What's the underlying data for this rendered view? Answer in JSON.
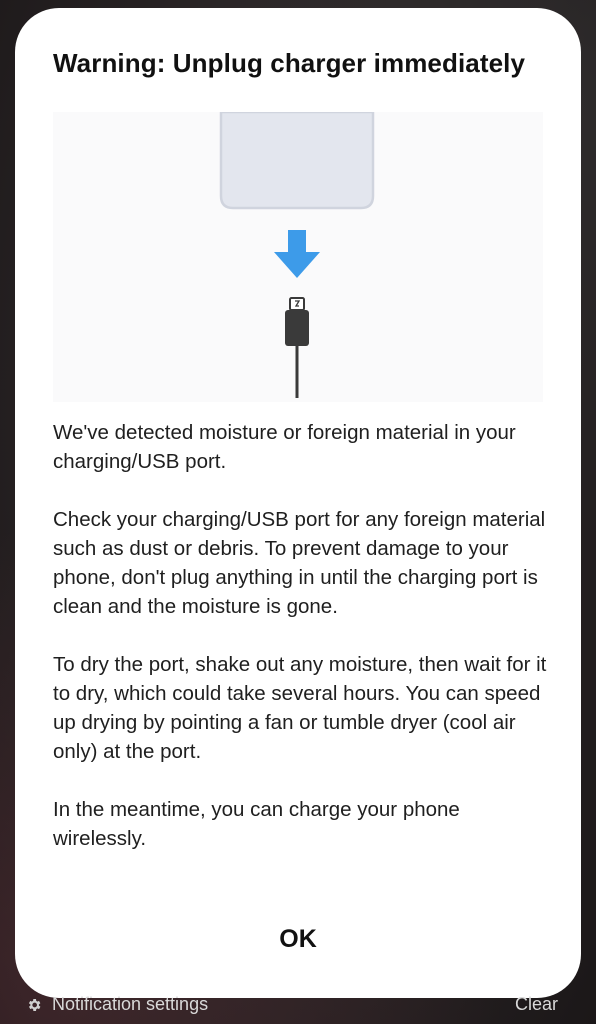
{
  "dialog": {
    "title": "Warning: Unplug charger immediately",
    "paragraphs": [
      "We've detected moisture or foreign material in your charging/USB port.",
      "Check your charging/USB port for any foreign material such as dust or debris. To prevent damage to your phone, don't plug anything in until the charging port is clean and the moisture is gone.",
      "To dry the port, shake out any moisture, then wait for it to dry, which could take several hours. You can speed up drying by pointing a fan or tumble dryer (cool air only) at the port.",
      "In the meantime, you can charge your phone wirelessly."
    ],
    "ok_label": "OK",
    "illustration": {
      "phone_icon": "phone-bottom-icon",
      "arrow_icon": "arrow-down-icon",
      "cable_icon": "usb-cable-icon",
      "arrow_color": "#3d9be9"
    }
  },
  "notification_shade": {
    "settings_icon": "gear-icon",
    "settings_label": "Notification settings",
    "clear_label": "Clear"
  }
}
